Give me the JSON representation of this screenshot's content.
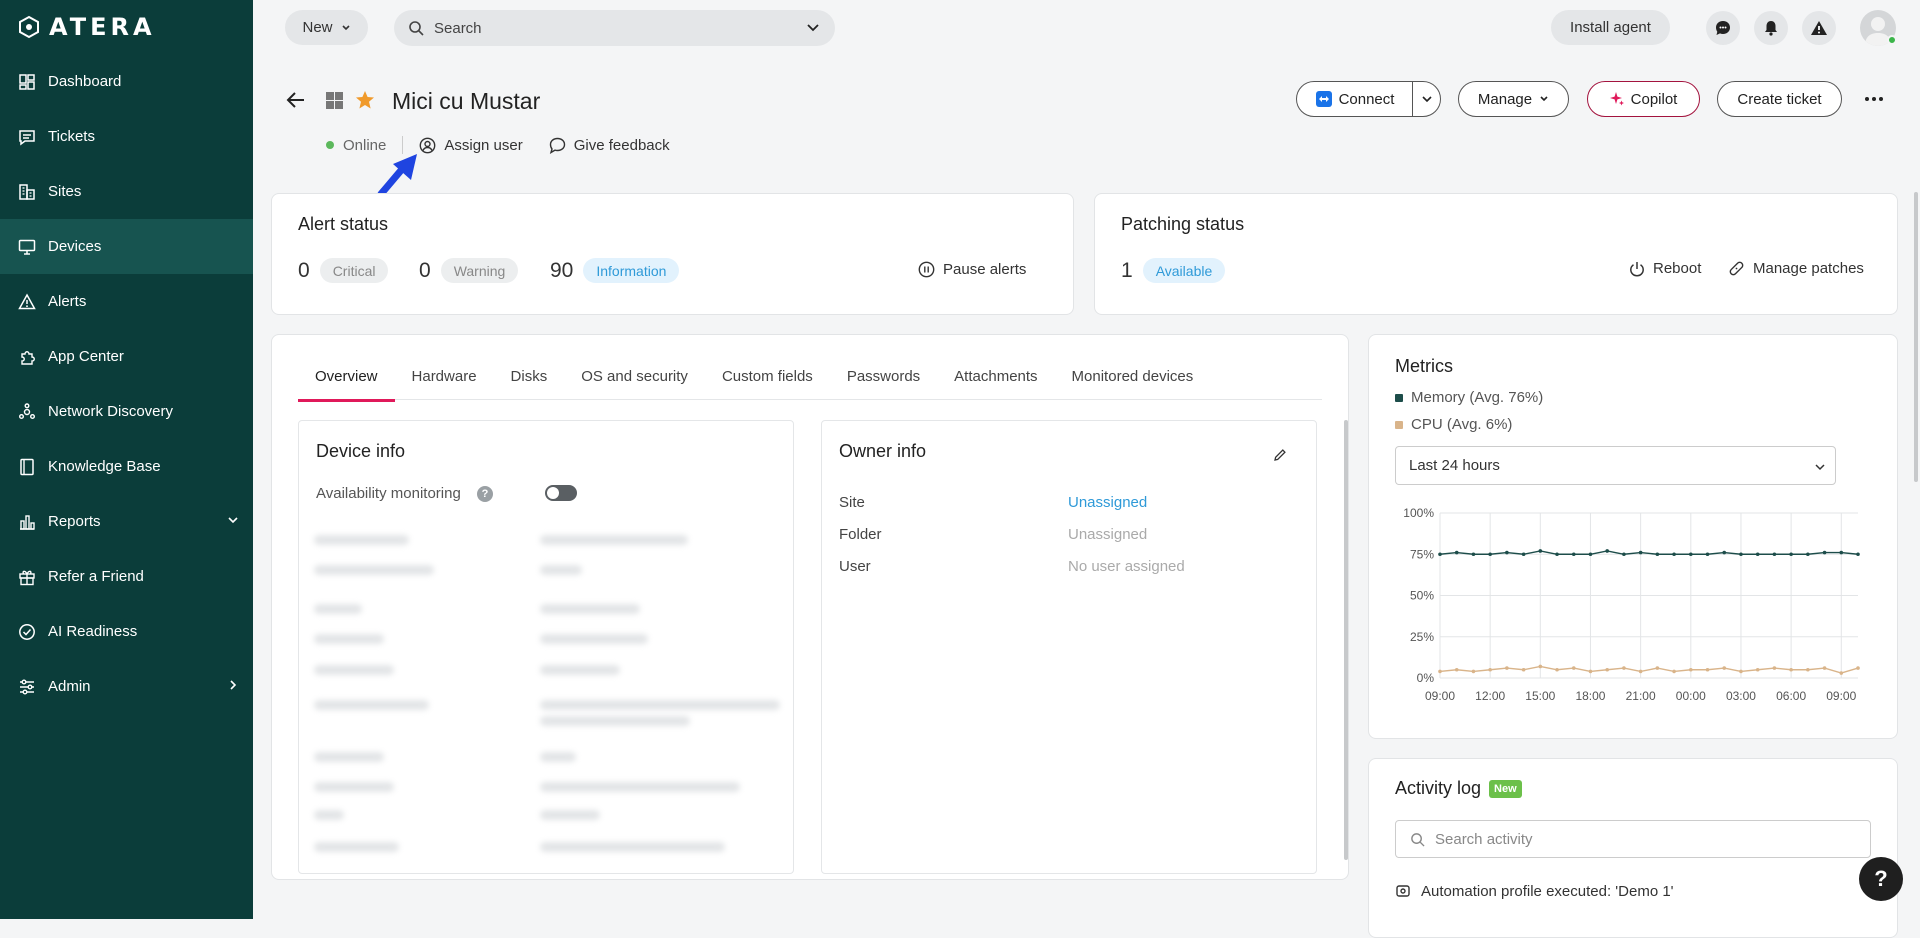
{
  "app": {
    "logo_text": "ATERA"
  },
  "sidebar": {
    "items": [
      {
        "label": "Dashboard",
        "icon": "dashboard-icon"
      },
      {
        "label": "Tickets",
        "icon": "tickets-icon"
      },
      {
        "label": "Sites",
        "icon": "sites-icon"
      },
      {
        "label": "Devices",
        "icon": "devices-icon",
        "active": true
      },
      {
        "label": "Alerts",
        "icon": "alerts-icon"
      },
      {
        "label": "App Center",
        "icon": "app-center-icon"
      },
      {
        "label": "Network Discovery",
        "icon": "network-discovery-icon"
      },
      {
        "label": "Knowledge Base",
        "icon": "knowledge-base-icon"
      },
      {
        "label": "Reports",
        "icon": "reports-icon",
        "chevron": "chevron-down-icon"
      },
      {
        "label": "Refer a Friend",
        "icon": "gift-icon"
      },
      {
        "label": "AI Readiness",
        "icon": "check-circle-icon"
      },
      {
        "label": "Admin",
        "icon": "sliders-icon",
        "chevron": "chevron-right-icon"
      }
    ]
  },
  "topbar": {
    "new_label": "New",
    "search_placeholder": "Search",
    "install_label": "Install agent",
    "icons": [
      "chat-icon",
      "bell-icon",
      "warning-icon",
      "avatar"
    ]
  },
  "device": {
    "name": "Mici cu Mustar",
    "status": "Online",
    "assign_user": "Assign user",
    "give_feedback": "Give feedback"
  },
  "actions": {
    "connect": "Connect",
    "manage": "Manage",
    "copilot": "Copilot",
    "create_ticket": "Create ticket"
  },
  "alert_status": {
    "title": "Alert status",
    "critical_count": "0",
    "critical_label": "Critical",
    "warning_count": "0",
    "warning_label": "Warning",
    "info_count": "90",
    "info_label": "Information",
    "pause_label": "Pause alerts"
  },
  "patching": {
    "title": "Patching status",
    "available_count": "1",
    "available_label": "Available",
    "reboot_label": "Reboot",
    "manage_label": "Manage patches"
  },
  "tabs": [
    "Overview",
    "Hardware",
    "Disks",
    "OS and security",
    "Custom fields",
    "Passwords",
    "Attachments",
    "Monitored devices"
  ],
  "active_tab": "Overview",
  "device_info": {
    "title": "Device info",
    "availability_label": "Availability monitoring",
    "availability_enabled": false
  },
  "owner_info": {
    "title": "Owner info",
    "site_label": "Site",
    "site_value": "Unassigned",
    "folder_label": "Folder",
    "folder_value": "Unassigned",
    "user_label": "User",
    "user_value": "No user assigned"
  },
  "metrics": {
    "title": "Metrics",
    "range": "Last 24 hours",
    "colors": {
      "memory": "#1d4d4a",
      "cpu": "#d9b48a"
    }
  },
  "chart_data": {
    "type": "line",
    "x": [
      "09:00",
      "10:00",
      "11:00",
      "12:00",
      "13:00",
      "14:00",
      "15:00",
      "16:00",
      "17:00",
      "18:00",
      "19:00",
      "20:00",
      "21:00",
      "22:00",
      "23:00",
      "00:00",
      "01:00",
      "02:00",
      "03:00",
      "04:00",
      "05:00",
      "06:00",
      "07:00",
      "08:00",
      "09:00",
      "10:00"
    ],
    "xticks": [
      "09:00",
      "12:00",
      "15:00",
      "18:00",
      "21:00",
      "00:00",
      "03:00",
      "06:00",
      "09:00"
    ],
    "yticks": [
      "0%",
      "25%",
      "50%",
      "75%",
      "100%"
    ],
    "ylim": [
      0,
      100
    ],
    "grid": true,
    "series": [
      {
        "name": "Memory (Avg. 76%)",
        "values": [
          75,
          76,
          75,
          75,
          76,
          75,
          77,
          75,
          75,
          75,
          77,
          75,
          76,
          75,
          75,
          75,
          75,
          76,
          75,
          75,
          75,
          75,
          75,
          76,
          76,
          75
        ]
      },
      {
        "name": "CPU (Avg. 6%)",
        "values": [
          4,
          5,
          4,
          5,
          6,
          5,
          7,
          5,
          6,
          4,
          5,
          6,
          4,
          6,
          4,
          5,
          5,
          6,
          4,
          5,
          6,
          5,
          5,
          6,
          3,
          6
        ]
      }
    ]
  },
  "activity_log": {
    "title": "Activity log",
    "badge": "New",
    "search_placeholder": "Search activity",
    "first_item": "Automation profile executed: 'Demo 1'"
  },
  "help_fab": "?"
}
